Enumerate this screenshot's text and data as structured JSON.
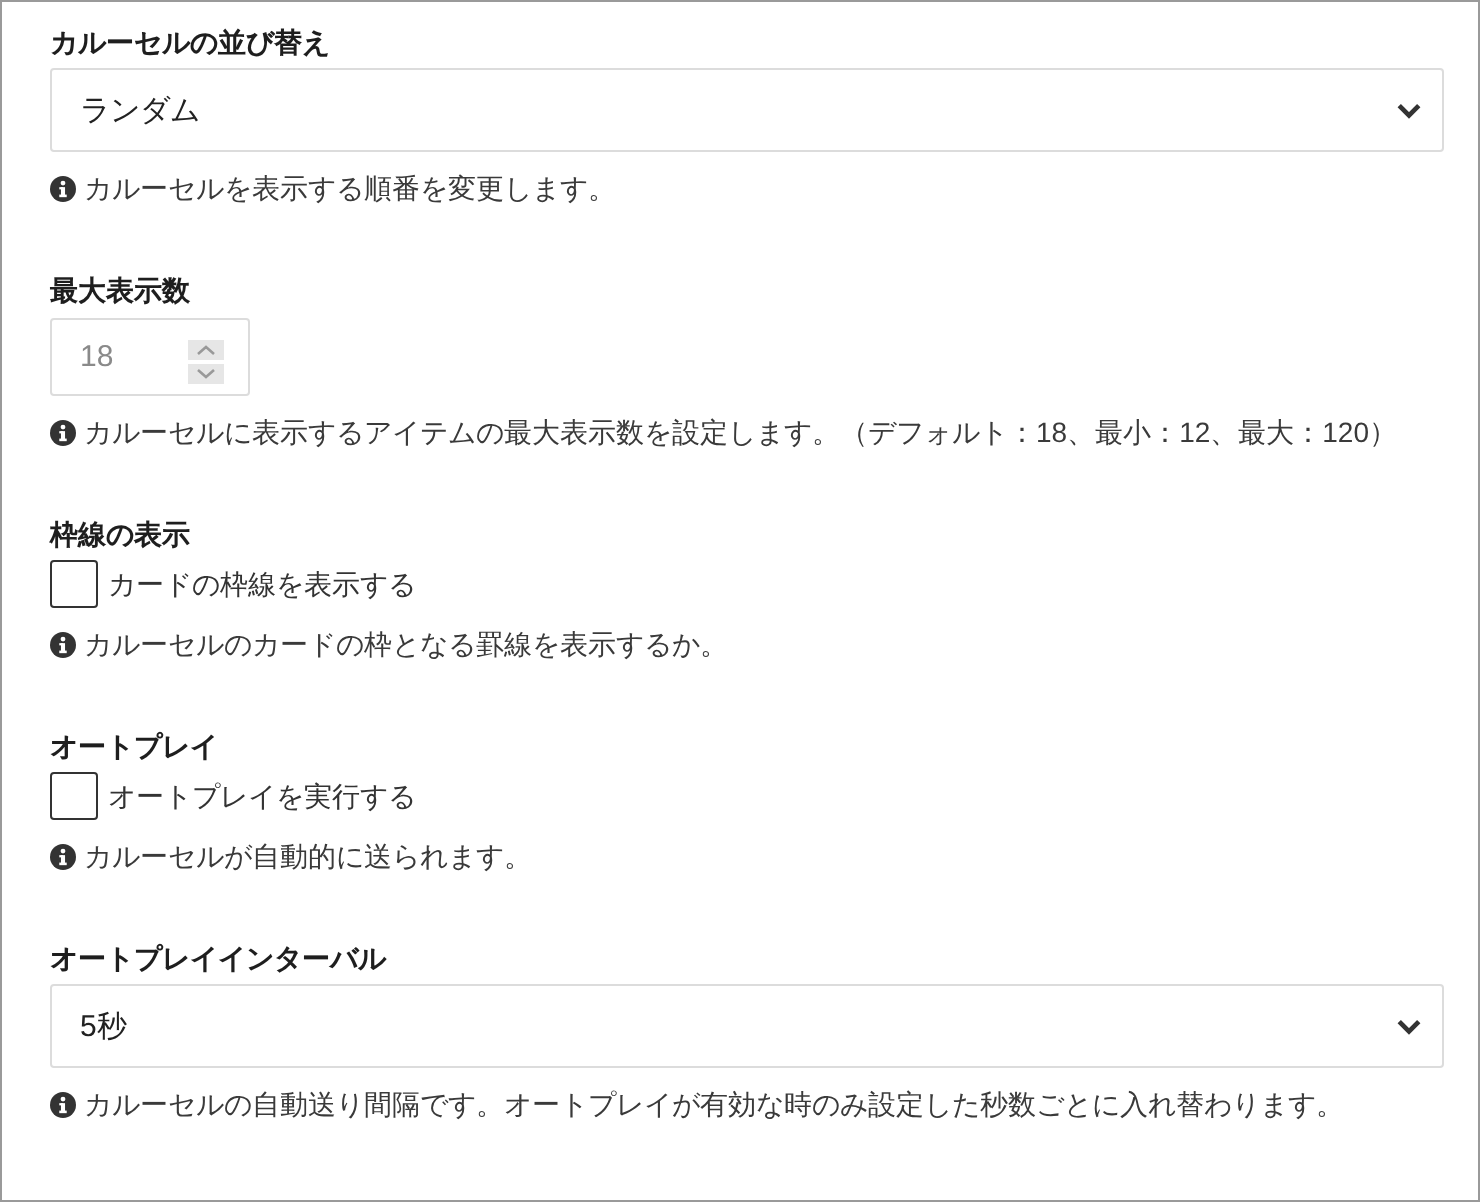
{
  "fields": [
    {
      "kind": "select",
      "label": "カルーセルの並び替え",
      "value": "ランダム",
      "help": "カルーセルを表示する順番を変更します。"
    },
    {
      "kind": "number",
      "label": "最大表示数",
      "placeholder": "18",
      "help": "カルーセルに表示するアイテムの最大表示数を設定します。（デフォルト：18、最小：12、最大：120）"
    },
    {
      "kind": "checkbox",
      "label": "枠線の表示",
      "option": "カードの枠線を表示する",
      "checked": false,
      "help": "カルーセルのカードの枠となる罫線を表示するか。"
    },
    {
      "kind": "checkbox",
      "label": "オートプレイ",
      "option": "オートプレイを実行する",
      "checked": false,
      "help": "カルーセルが自動的に送られます。"
    },
    {
      "kind": "select",
      "label": "オートプレイインターバル",
      "value": "5秒",
      "help": "カルーセルの自動送り間隔です。オートプレイが有効な時のみ設定した秒数ごとに入れ替わります。"
    }
  ]
}
